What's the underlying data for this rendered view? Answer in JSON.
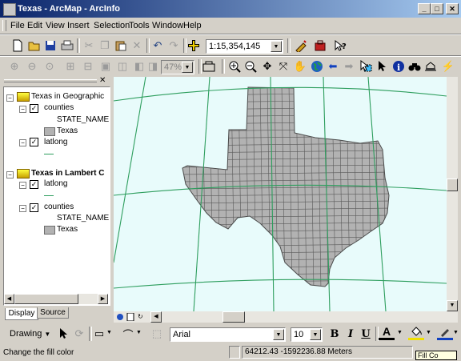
{
  "window": {
    "title": "Texas - ArcMap - ArcInfo",
    "minimize": "_",
    "maximize": "□",
    "close": "✕"
  },
  "menu": [
    "File",
    "Edit",
    "View",
    "Insert",
    "Selection",
    "Tools",
    "Window",
    "Help"
  ],
  "standard_toolbar": {
    "scale": "1:15,354,145",
    "buttons": [
      "new-icon",
      "open-icon",
      "save-icon",
      "print-icon",
      "cut-icon",
      "copy-icon",
      "paste-icon",
      "delete-icon",
      "undo-icon",
      "redo-icon",
      "add-data-icon",
      "editor-icon",
      "arctoolbox-icon",
      "whats-this-icon"
    ]
  },
  "layout_toolbar": {
    "zoom_percent": "47%"
  },
  "toc": {
    "frames": [
      {
        "name": "Texas in Geographic",
        "active": false,
        "layers": [
          {
            "name": "counties",
            "checked": true,
            "field": "STATE_NAME",
            "class_label": "Texas",
            "symbol": "polygon"
          },
          {
            "name": "latlong",
            "checked": true,
            "symbol": "line"
          }
        ]
      },
      {
        "name": "Texas in Lambert C",
        "active": true,
        "layers": [
          {
            "name": "latlong",
            "checked": true,
            "symbol": "line"
          },
          {
            "name": "counties",
            "checked": true,
            "field": "STATE_NAME",
            "class_label": "Texas",
            "symbol": "polygon"
          }
        ]
      }
    ],
    "tabs": [
      "Display",
      "Source"
    ],
    "active_tab": "Display"
  },
  "drawing_toolbar": {
    "drawing_label": "Drawing",
    "font": "Arial",
    "font_size": "10",
    "bold": "B",
    "italic": "I",
    "underline": "U",
    "font_color_label": "A"
  },
  "status_bar": {
    "message": "Change the fill color",
    "coordinates": "64212.43  -1592236.88 Meters",
    "tooltip_fragment": "Fill Co"
  },
  "colors": {
    "map_background": "#e8fbfb",
    "state_fill": "#b2b2b2",
    "graticule": "#2e9e5e",
    "title_bar": "#0a246a"
  }
}
